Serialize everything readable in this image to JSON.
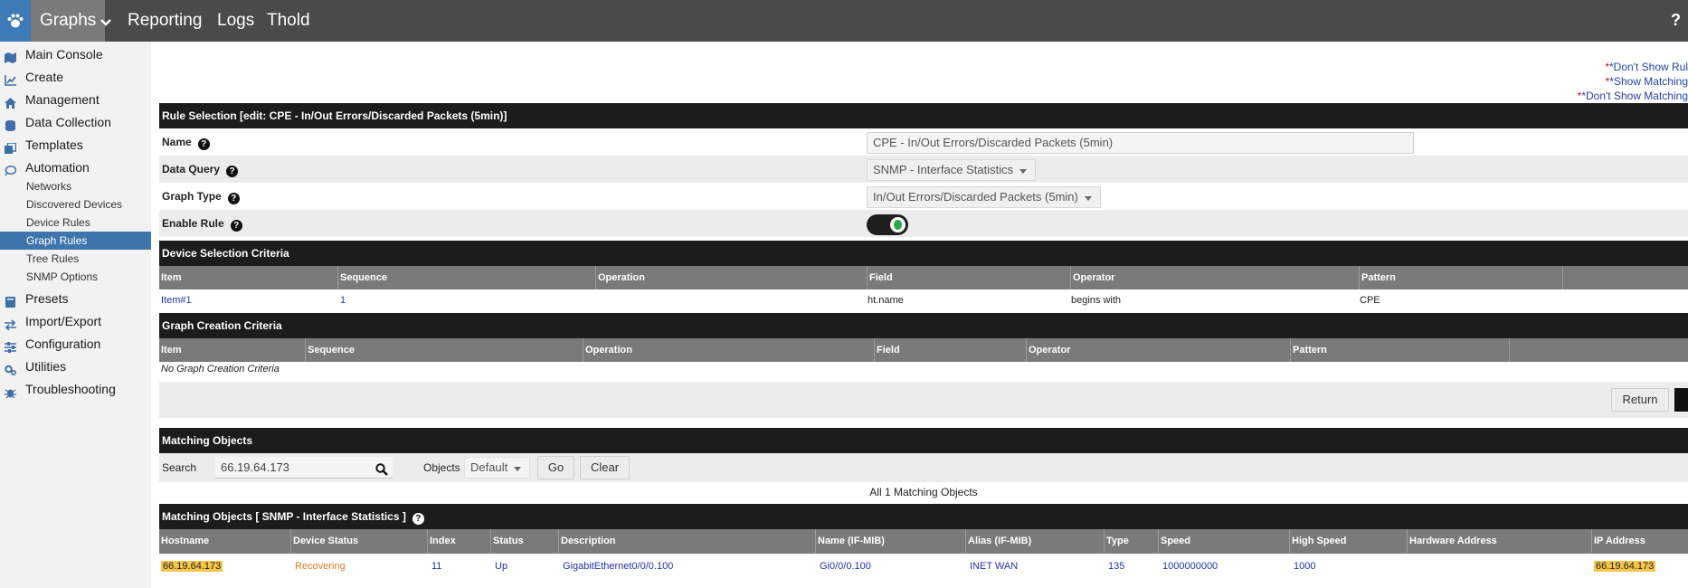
{
  "nav": {
    "tabs": [
      "Graphs",
      "Reporting",
      "Logs",
      "Thold"
    ],
    "help": "?"
  },
  "sidebar": {
    "items": [
      {
        "label": "Main Console",
        "icon": "map-icon"
      },
      {
        "label": "Create",
        "icon": "chart-icon"
      },
      {
        "label": "Management",
        "icon": "home-icon"
      },
      {
        "label": "Data Collection",
        "icon": "database-icon"
      },
      {
        "label": "Templates",
        "icon": "copy-icon"
      },
      {
        "label": "Automation",
        "icon": "chat-icon"
      }
    ],
    "sub_items": [
      "Networks",
      "Discovered Devices",
      "Device Rules",
      "Graph Rules",
      "Tree Rules",
      "SNMP Options"
    ],
    "active_sub": "Graph Rules",
    "items2": [
      {
        "label": "Presets",
        "icon": "book-icon"
      },
      {
        "label": "Import/Export",
        "icon": "exchange-icon"
      },
      {
        "label": "Configuration",
        "icon": "sliders-icon"
      },
      {
        "label": "Utilities",
        "icon": "cogs-icon"
      },
      {
        "label": "Troubleshooting",
        "icon": "bug-icon"
      }
    ]
  },
  "toplinks": [
    "*Don't Show Rul",
    "*Show Matching",
    "*Don't Show Matching"
  ],
  "rule_section": {
    "title": "Rule Selection [edit: CPE - In/Out Errors/Discarded Packets (5min)]",
    "name_label": "Name",
    "name_value": "CPE - In/Out Errors/Discarded Packets (5min)",
    "data_query_label": "Data Query",
    "data_query_value": "SNMP - Interface Statistics",
    "graph_type_label": "Graph Type",
    "graph_type_value": "In/Out Errors/Discarded Packets (5min)",
    "enable_label": "Enable Rule",
    "enabled": true
  },
  "device_criteria": {
    "title": "Device Selection Criteria",
    "headers": [
      "Item",
      "Sequence",
      "Operation",
      "Field",
      "Operator",
      "Pattern"
    ],
    "rows": [
      [
        "Item#1",
        "1",
        "",
        "ht.name",
        "begins with",
        "CPE"
      ]
    ]
  },
  "graph_criteria": {
    "title": "Graph Creation Criteria",
    "headers": [
      "Item",
      "Sequence",
      "Operation",
      "Field",
      "Operator",
      "Pattern"
    ],
    "empty": "No Graph Creation Criteria"
  },
  "return_button": "Return",
  "matching": {
    "title": "Matching Objects",
    "search_label": "Search",
    "search_value": "66.19.64.173",
    "objects_label": "Objects",
    "objects_value": "Default",
    "go": "Go",
    "clear": "Clear",
    "summary": "All 1 Matching Objects",
    "subtitle": "Matching Objects [ SNMP - Interface Statistics ]",
    "headers": [
      "Hostname",
      "Device Status",
      "Index",
      "Status",
      "Description",
      "Name (IF-MIB)",
      "Alias (IF-MIB)",
      "Type",
      "Speed",
      "High Speed",
      "Hardware Address",
      "IP Address"
    ],
    "rows": [
      [
        "66.19.64.173",
        "Recovering",
        "11",
        "Up",
        "GigabitEthernet0/0/0.100",
        "Gi0/0/0.100",
        "INET WAN",
        "135",
        "1000000000",
        "1000",
        "",
        "66.19.64.173"
      ]
    ]
  }
}
